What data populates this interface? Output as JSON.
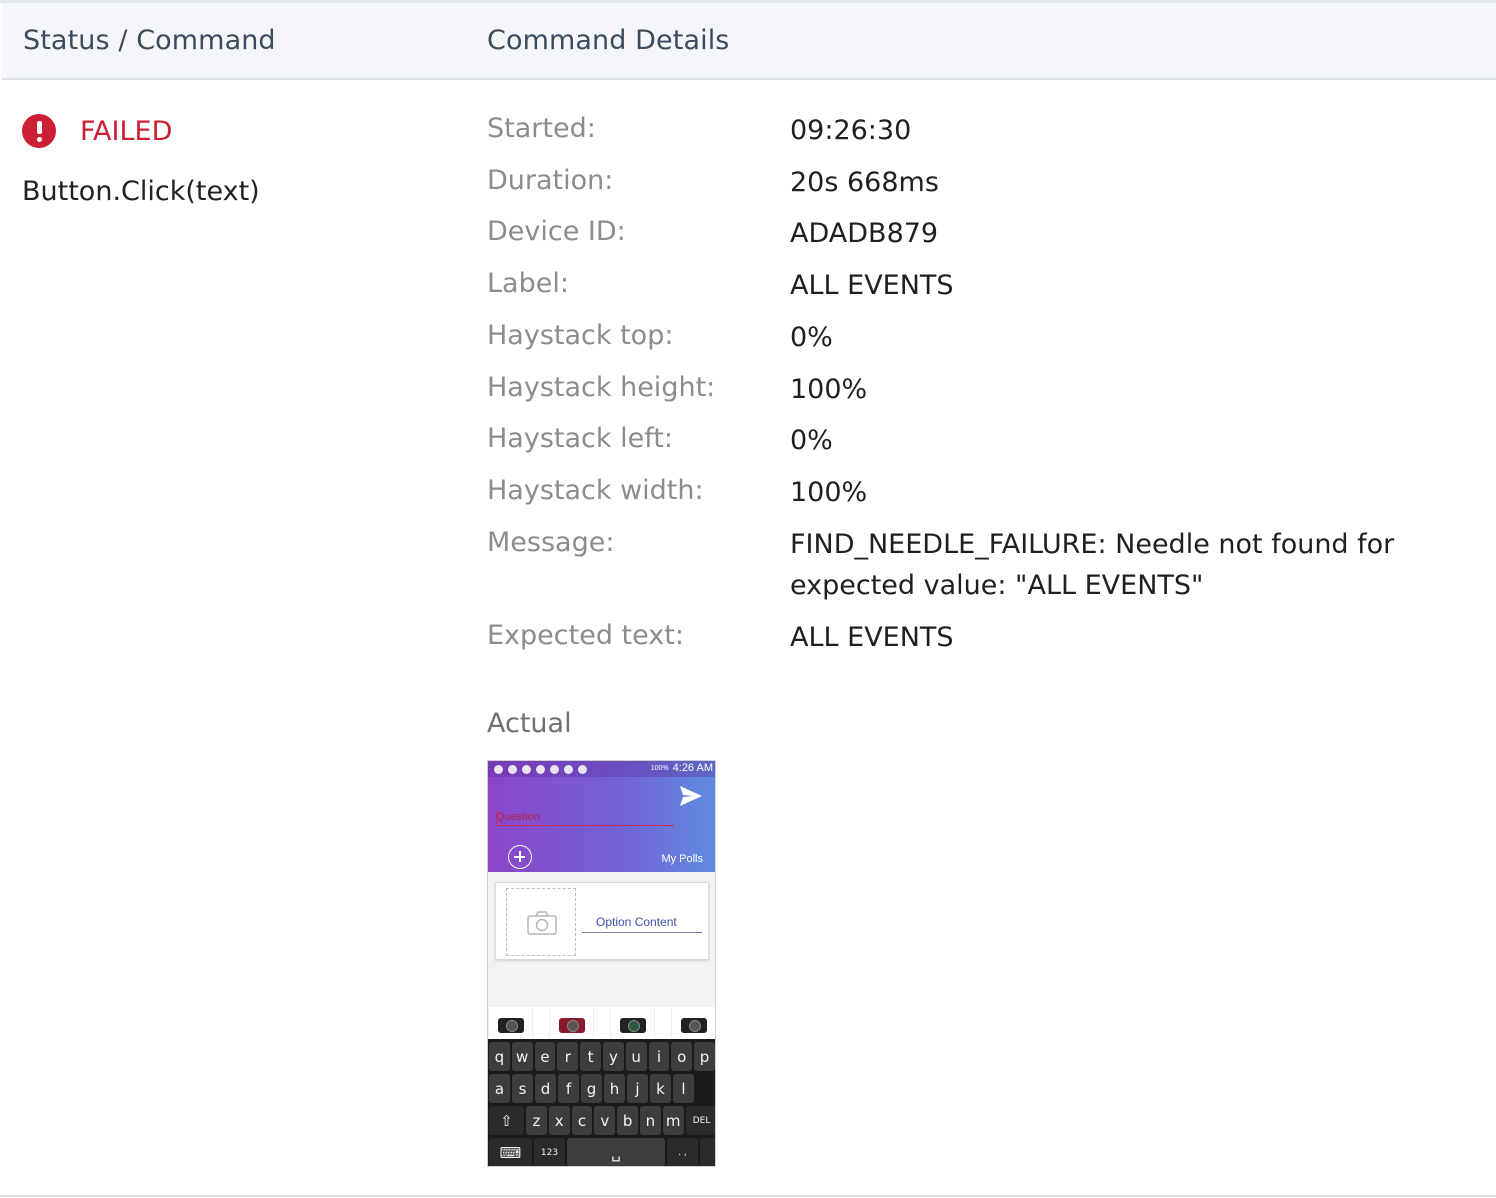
{
  "table": {
    "headers": {
      "status_command": "Status / Command",
      "command_details": "Command Details"
    }
  },
  "result": {
    "status": "FAILED",
    "status_color": "#cc1f36",
    "command": "Button.Click(text)"
  },
  "details": [
    {
      "label": "Started:",
      "value": "09:26:30"
    },
    {
      "label": "Duration:",
      "value": "20s 668ms"
    },
    {
      "label": "Device ID:",
      "value": "ADADB879"
    },
    {
      "label": "Label:",
      "value": "ALL EVENTS"
    },
    {
      "label": "Haystack top:",
      "value": "0%"
    },
    {
      "label": "Haystack height:",
      "value": "100%"
    },
    {
      "label": "Haystack left:",
      "value": "0%"
    },
    {
      "label": "Haystack width:",
      "value": "100%"
    },
    {
      "label": "Message:",
      "value": "FIND_NEEDLE_FAILURE: Needle not found for expected value: \"ALL EVENTS\""
    },
    {
      "label": "Expected text:",
      "value": "ALL EVENTS"
    }
  ],
  "actual": {
    "label": "Actual",
    "phone": {
      "status_bar": {
        "battery": "100%",
        "time": "4:26 AM"
      },
      "question_placeholder": "Question",
      "my_polls": "My Polls",
      "option_placeholder": "Option Content",
      "keyboard": {
        "row1": [
          "q",
          "w",
          "e",
          "r",
          "t",
          "y",
          "u",
          "i",
          "o",
          "p"
        ],
        "row2": [
          "a",
          "s",
          "d",
          "f",
          "g",
          "h",
          "j",
          "k",
          "l"
        ],
        "row3": [
          "z",
          "x",
          "c",
          "v",
          "b",
          "n",
          "m"
        ],
        "del_label": "DEL",
        "numbers_key": "123",
        "punct_key": ". ,"
      }
    }
  }
}
